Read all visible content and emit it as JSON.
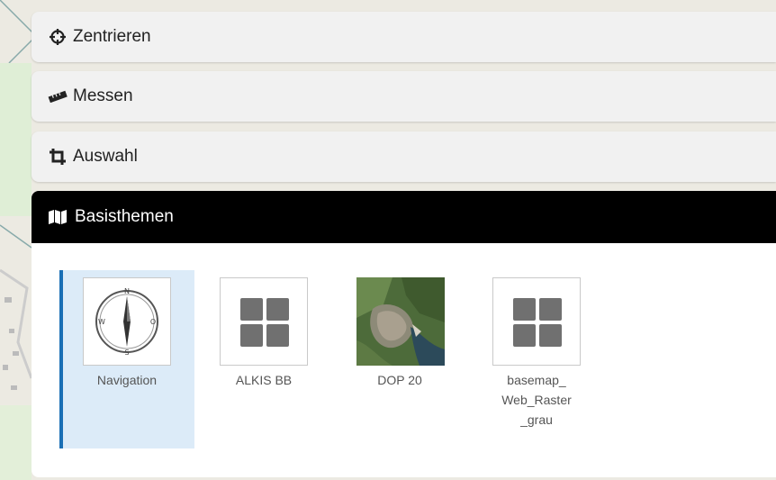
{
  "tools": {
    "zentrieren_label": "Zentrieren",
    "messen_label": "Messen",
    "auswahl_label": "Auswahl"
  },
  "basisthemen": {
    "title": "Basisthemen",
    "items": [
      {
        "label": "Navigation",
        "icon": "compass-icon",
        "selected": true
      },
      {
        "label": "ALKIS BB",
        "icon": "grid-icon",
        "selected": false
      },
      {
        "label": "DOP 20",
        "icon": "aerial-photo-thumbnail",
        "selected": false
      },
      {
        "label": "basemap_\nWeb_Raster\n_grau",
        "icon": "grid-icon",
        "selected": false
      }
    ]
  },
  "colors": {
    "active_header_bg": "#000000",
    "selected_tile_bg": "#dcebf8",
    "selected_tile_accent": "#1a6fb5",
    "panel_bg": "#f1f1f1"
  }
}
